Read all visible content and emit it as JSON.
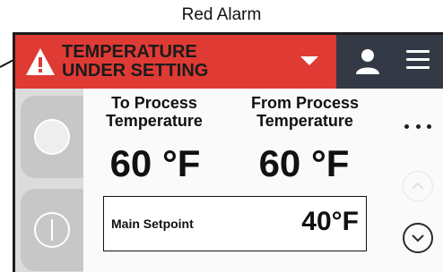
{
  "caption": "Red Alarm",
  "alarm": {
    "line1": "TEMPERATURE",
    "line2": "UNDER SETTING",
    "color": "#e03a34",
    "icon": "warning-triangle-icon",
    "dropdown_icon": "caret-down-icon"
  },
  "header": {
    "background": "#333a45",
    "user_icon": "user-icon",
    "menu_icon": "hamburger-menu-icon"
  },
  "left_rail": {
    "start_button_icon": "circle-icon",
    "power_button_icon": "power-icon"
  },
  "temperatures": {
    "to_process_label_1": "To Process",
    "to_process_label_2": "Temperature",
    "to_process_value": "60 °F",
    "from_process_label_1": "From Process",
    "from_process_label_2": "Temperature",
    "from_process_value": "60 °F"
  },
  "setpoint": {
    "label": "Main Setpoint",
    "value": "40°F"
  },
  "right_rail": {
    "more_icon": "more-dots-icon",
    "up_icon": "chevron-up-icon",
    "down_icon": "chevron-down-icon"
  }
}
